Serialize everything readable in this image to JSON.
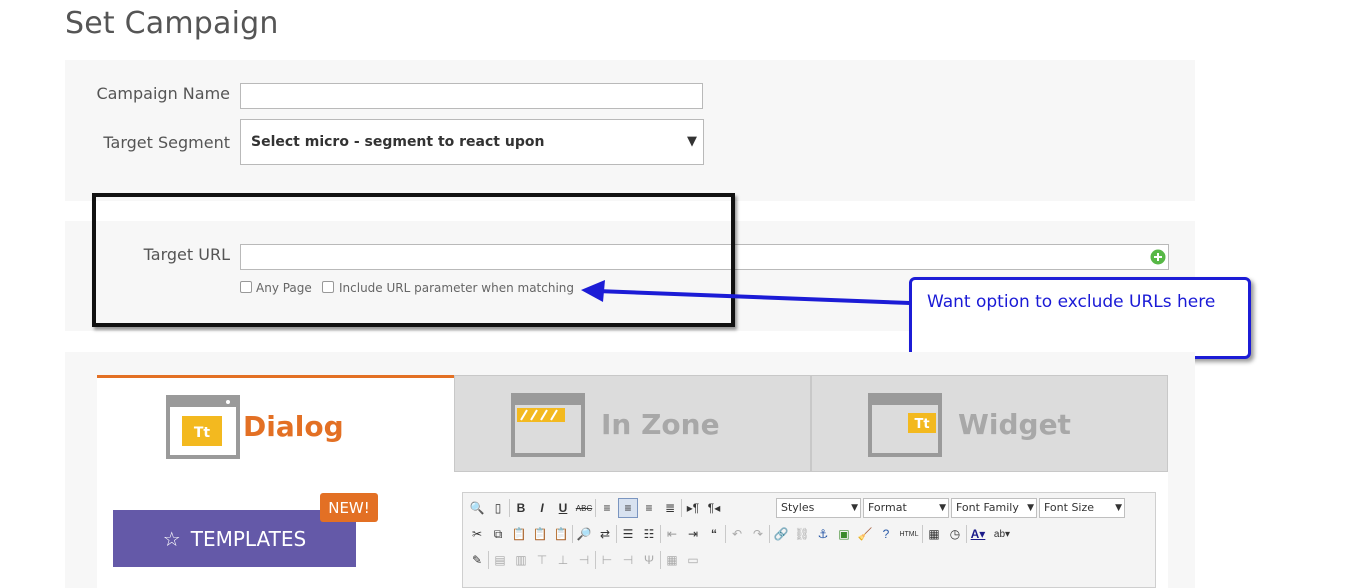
{
  "page": {
    "title": "Set Campaign"
  },
  "form": {
    "campaign_name_label": "Campaign Name",
    "campaign_name_value": "",
    "target_segment_label": "Target Segment",
    "target_segment_value": "Select micro - segment to react upon",
    "target_url_label": "Target URL",
    "target_url_value": "",
    "any_page_label": "Any Page",
    "include_param_label": "Include URL parameter when matching"
  },
  "annotation": {
    "note": "Want option to exclude URLs here"
  },
  "tabs": [
    {
      "label": "Dialog",
      "icon_text": "Tt",
      "active": true
    },
    {
      "label": "In Zone",
      "icon_text": "",
      "active": false
    },
    {
      "label": "Widget",
      "icon_text": "Tt",
      "active": false
    }
  ],
  "templates": {
    "label": "TEMPLATES",
    "badge": "NEW!"
  },
  "editor": {
    "styles": "Styles",
    "format": "Format",
    "font_family": "Font Family",
    "font_size": "Font Size",
    "html_label": "HTML"
  },
  "colors": {
    "accent": "#e37024",
    "templates_button": "#6459a8",
    "annotation_blue": "#1c1cd6"
  }
}
